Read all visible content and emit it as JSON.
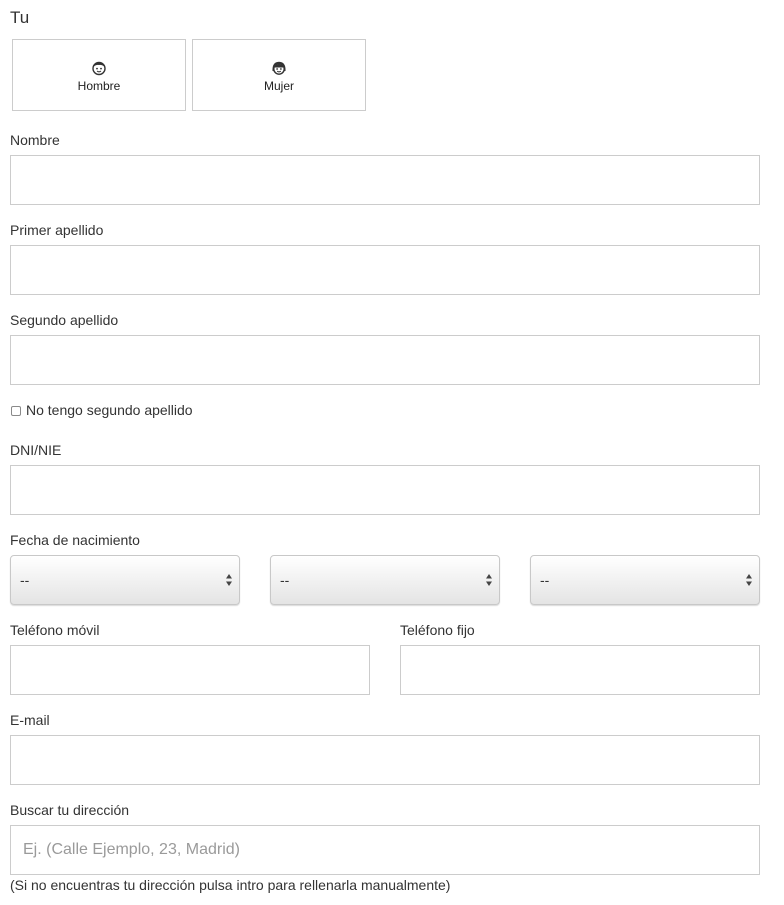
{
  "section": {
    "title": "Tu"
  },
  "gender": {
    "male": {
      "label": "Hombre",
      "icon": "male-face-icon"
    },
    "female": {
      "label": "Mujer",
      "icon": "female-face-icon"
    }
  },
  "fields": {
    "first_name": {
      "label": "Nombre",
      "value": ""
    },
    "first_surname": {
      "label": "Primer apellido",
      "value": ""
    },
    "second_surname": {
      "label": "Segundo apellido",
      "value": ""
    },
    "no_second_surname": {
      "label": "No tengo segundo apellido",
      "checked": false
    },
    "dni": {
      "label": "DNI/NIE",
      "value": ""
    },
    "birthdate": {
      "label": "Fecha de nacimiento",
      "day": "--",
      "month": "--",
      "year": "--"
    },
    "mobile": {
      "label": "Teléfono móvil",
      "value": ""
    },
    "landline": {
      "label": "Teléfono fijo",
      "value": ""
    },
    "email": {
      "label": "E-mail",
      "value": ""
    },
    "address": {
      "label": "Buscar tu dirección",
      "placeholder": "Ej. (Calle Ejemplo, 23, Madrid)",
      "hint": "(Si no encuentras tu dirección pulsa intro para rellenarla manualmente)"
    }
  }
}
